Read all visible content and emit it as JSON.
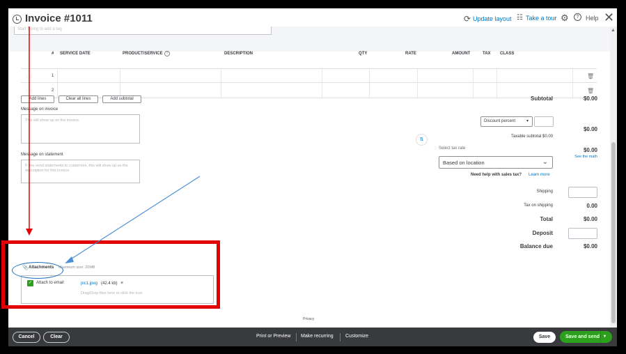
{
  "header": {
    "title": "Invoice #1011",
    "update_layout": "Update layout",
    "take_tour": "Take a tour",
    "help": "Help",
    "tag_placeholder": "Start typing to add a tag"
  },
  "table": {
    "columns": [
      "#",
      "SERVICE DATE",
      "PRODUCT/SERVICE",
      "DESCRIPTION",
      "QTY",
      "RATE",
      "AMOUNT",
      "TAX",
      "CLASS"
    ],
    "rows": [
      {
        "num": "1"
      },
      {
        "num": "2"
      }
    ]
  },
  "buttons": {
    "add_lines": "Add lines",
    "clear_all_lines": "Clear all lines",
    "add_subtotal": "Add subtotal"
  },
  "message_invoice": {
    "label": "Message on invoice",
    "placeholder": "This will show up on the invoice."
  },
  "message_statement": {
    "label": "Message on statement",
    "placeholder": "If you send statements to customers, this will show up as the description for this invoice."
  },
  "totals": {
    "subtotal_label": "Subtotal",
    "subtotal_value": "$0.00",
    "discount_select": "Discount percent",
    "discount_value": "$0.00",
    "taxable_subtotal": "Taxable subtotal $0.00",
    "select_tax_rate": "Select tax rate",
    "tax_value": "$0.00",
    "see_math": "See the math",
    "tax_select": "Based on location",
    "help_sales_tax": "Need help with sales tax?",
    "learn_more": "Learn more",
    "shipping_label": "Shipping",
    "tax_on_shipping_label": "Tax on shipping",
    "tax_on_shipping_value": "0.00",
    "total_label": "Total",
    "total_value": "$0.00",
    "deposit_label": "Deposit",
    "balance_due_label": "Balance due",
    "balance_due_value": "$0.00"
  },
  "attachments": {
    "label": "Attachments",
    "max_size": "Maximum size: 20MB",
    "attach_email": "Attach to email",
    "file_name": "pic1.jpeg",
    "file_size": "(42.4 kb)",
    "drop_hint": "Drag/Drop files here or click the icon"
  },
  "privacy": "Privacy",
  "footer": {
    "cancel": "Cancel",
    "clear": "Clear",
    "print_preview": "Print or Preview",
    "make_recurring": "Make recurring",
    "customize": "Customize",
    "save": "Save",
    "save_and_send": "Save and send"
  },
  "colors": {
    "link": "#0077c5",
    "green": "#2ca01c",
    "annotation_red": "#e20000",
    "annotation_blue": "#1a6fc1"
  }
}
